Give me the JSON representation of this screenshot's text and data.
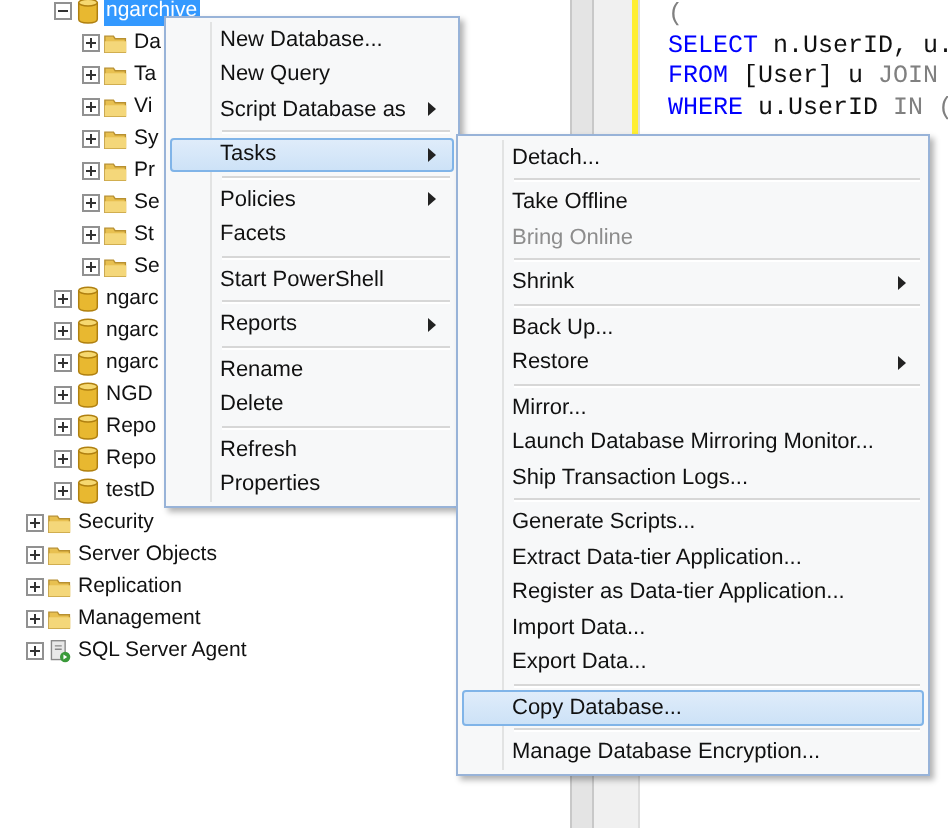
{
  "tree": {
    "database_nodes": [
      {
        "label": "ngarchive",
        "kind": "database",
        "expanded": true,
        "selected": true,
        "children": [
          {
            "label": "Da",
            "kind": "folder",
            "expanded": false,
            "selected": false
          },
          {
            "label": "Ta",
            "kind": "folder",
            "expanded": false,
            "selected": false
          },
          {
            "label": "Vi",
            "kind": "folder",
            "expanded": false,
            "selected": false
          },
          {
            "label": "Sy",
            "kind": "folder",
            "expanded": false,
            "selected": false
          },
          {
            "label": "Pr",
            "kind": "folder",
            "expanded": false,
            "selected": false
          },
          {
            "label": "Se",
            "kind": "folder",
            "expanded": false,
            "selected": false
          },
          {
            "label": "St",
            "kind": "folder",
            "expanded": false,
            "selected": false
          },
          {
            "label": "Se",
            "kind": "folder",
            "expanded": false,
            "selected": false
          }
        ]
      },
      {
        "label": "ngarc",
        "kind": "database",
        "expanded": false,
        "selected": false
      },
      {
        "label": "ngarc",
        "kind": "database",
        "expanded": false,
        "selected": false
      },
      {
        "label": "ngarc",
        "kind": "database",
        "expanded": false,
        "selected": false
      },
      {
        "label": "NGD",
        "kind": "database",
        "expanded": false,
        "selected": false
      },
      {
        "label": "Repo",
        "kind": "database",
        "expanded": false,
        "selected": false
      },
      {
        "label": "Repo",
        "kind": "database",
        "expanded": false,
        "selected": false
      },
      {
        "label": "testD",
        "kind": "database",
        "expanded": false,
        "selected": false
      }
    ],
    "server_nodes": [
      {
        "label": "Security",
        "kind": "folder",
        "expanded": false,
        "selected": false
      },
      {
        "label": "Server Objects",
        "kind": "folder",
        "expanded": false,
        "selected": false
      },
      {
        "label": "Replication",
        "kind": "folder",
        "expanded": false,
        "selected": false
      },
      {
        "label": "Management",
        "kind": "folder",
        "expanded": false,
        "selected": false
      },
      {
        "label": "SQL Server Agent",
        "kind": "agent",
        "expanded": false,
        "selected": false
      }
    ]
  },
  "editor": {
    "lines": [
      [
        {
          "text": "(",
          "kind": "punct"
        }
      ],
      [
        {
          "text": "SELECT",
          "kind": "keyword"
        },
        {
          "text": " n.UserID, u.",
          "kind": "plain"
        }
      ],
      [
        {
          "text": "FROM",
          "kind": "keyword"
        },
        {
          "text": " [User] u ",
          "kind": "plain"
        },
        {
          "text": "JOIN",
          "kind": "operator"
        }
      ],
      [
        {
          "text": "WHERE",
          "kind": "keyword"
        },
        {
          "text": " u.UserID ",
          "kind": "plain"
        },
        {
          "text": "IN",
          "kind": "operator"
        },
        {
          "text": " (",
          "kind": "punct"
        }
      ]
    ]
  },
  "context_menu": {
    "groups": [
      [
        {
          "label": "New Database...",
          "submenu": false,
          "selected": false
        },
        {
          "label": "New Query",
          "submenu": false,
          "selected": false
        },
        {
          "label": "Script Database as",
          "submenu": true,
          "selected": false
        }
      ],
      [
        {
          "label": "Tasks",
          "submenu": true,
          "selected": true
        }
      ],
      [
        {
          "label": "Policies",
          "submenu": true,
          "selected": false
        },
        {
          "label": "Facets",
          "submenu": false,
          "selected": false
        }
      ],
      [
        {
          "label": "Start PowerShell",
          "submenu": false,
          "selected": false
        }
      ],
      [
        {
          "label": "Reports",
          "submenu": true,
          "selected": false
        }
      ],
      [
        {
          "label": "Rename",
          "submenu": false,
          "selected": false
        },
        {
          "label": "Delete",
          "submenu": false,
          "selected": false
        }
      ],
      [
        {
          "label": "Refresh",
          "submenu": false,
          "selected": false
        },
        {
          "label": "Properties",
          "submenu": false,
          "selected": false
        }
      ]
    ]
  },
  "tasks_submenu": {
    "groups": [
      [
        {
          "label": "Detach...",
          "submenu": false,
          "selected": false,
          "disabled": false
        }
      ],
      [
        {
          "label": "Take Offline",
          "submenu": false,
          "selected": false,
          "disabled": false
        },
        {
          "label": "Bring Online",
          "submenu": false,
          "selected": false,
          "disabled": true
        }
      ],
      [
        {
          "label": "Shrink",
          "submenu": true,
          "selected": false,
          "disabled": false
        }
      ],
      [
        {
          "label": "Back Up...",
          "submenu": false,
          "selected": false,
          "disabled": false
        },
        {
          "label": "Restore",
          "submenu": true,
          "selected": false,
          "disabled": false
        }
      ],
      [
        {
          "label": "Mirror...",
          "submenu": false,
          "selected": false,
          "disabled": false
        },
        {
          "label": "Launch Database Mirroring Monitor...",
          "submenu": false,
          "selected": false,
          "disabled": false
        },
        {
          "label": "Ship Transaction Logs...",
          "submenu": false,
          "selected": false,
          "disabled": false
        }
      ],
      [
        {
          "label": "Generate Scripts...",
          "submenu": false,
          "selected": false,
          "disabled": false
        },
        {
          "label": "Extract Data-tier Application...",
          "submenu": false,
          "selected": false,
          "disabled": false
        },
        {
          "label": "Register as Data-tier Application...",
          "submenu": false,
          "selected": false,
          "disabled": false
        },
        {
          "label": "Import Data...",
          "submenu": false,
          "selected": false,
          "disabled": false
        },
        {
          "label": "Export Data...",
          "submenu": false,
          "selected": false,
          "disabled": false
        }
      ],
      [
        {
          "label": "Copy Database...",
          "submenu": false,
          "selected": true,
          "disabled": false
        }
      ],
      [
        {
          "label": "Manage Database Encryption...",
          "submenu": false,
          "selected": false,
          "disabled": false
        }
      ]
    ]
  }
}
